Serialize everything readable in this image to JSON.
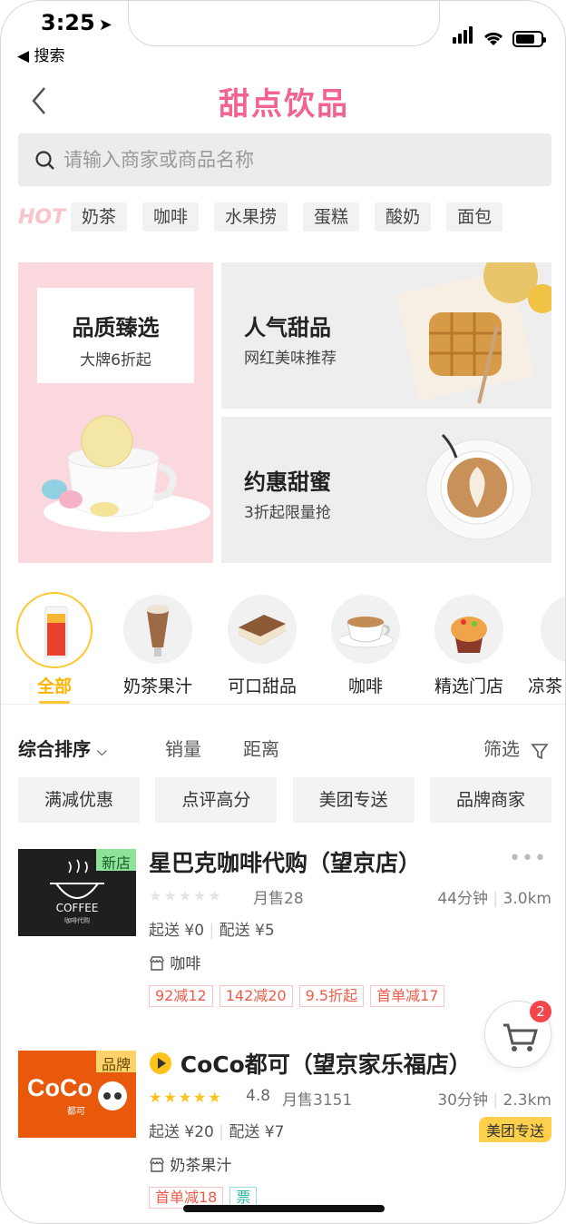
{
  "status_bar": {
    "time": "3:25",
    "back_app": "◀ 搜索"
  },
  "header": {
    "title": "甜点饮品"
  },
  "search": {
    "placeholder": "请输入商家或商品名称"
  },
  "hot": {
    "label": "HOT",
    "tags": [
      "奶茶",
      "咖啡",
      "水果捞",
      "蛋糕",
      "酸奶",
      "面包"
    ]
  },
  "banners": [
    {
      "title": "品质臻选",
      "subtitle": "大牌6折起"
    },
    {
      "title": "人气甜品",
      "subtitle": "网红美味推荐"
    },
    {
      "title": "约惠甜蜜",
      "subtitle": "3折起限量抢"
    }
  ],
  "categories": [
    {
      "label": "全部",
      "active": true
    },
    {
      "label": "奶茶果汁"
    },
    {
      "label": "可口甜品"
    },
    {
      "label": "咖啡"
    },
    {
      "label": "精选门店"
    },
    {
      "label": "凉茶"
    }
  ],
  "sort": {
    "main": "综合排序",
    "sales": "销量",
    "distance": "距离",
    "filter": "筛选"
  },
  "filters": [
    "满减优惠",
    "点评高分",
    "美团专送",
    "品牌商家"
  ],
  "stores": [
    {
      "badge": "新店",
      "thumb_text": "COFFEE",
      "thumb_sub": "咖啡代购",
      "name": "星巴克咖啡代购（望京店）",
      "rating": "",
      "monthly_sales": "月售28",
      "time": "44分钟",
      "distance": "3.0km",
      "min_order": "起送 ¥0",
      "delivery_fee": "配送 ¥5",
      "category": "咖啡",
      "promos": [
        "92减12",
        "142减20",
        "9.5折起",
        "首单减17"
      ]
    },
    {
      "badge": "品牌",
      "thumb_text": "CoCo",
      "thumb_sub": "都可",
      "name": "CoCo都可（望京家乐福店）",
      "rating": "4.8",
      "monthly_sales": "月售3151",
      "time": "30分钟",
      "distance": "2.3km",
      "min_order": "起送 ¥20",
      "delivery_fee": "配送 ¥7",
      "delivery_badge": "美团专送",
      "category": "奶茶果汁",
      "promos": [
        "首单减18"
      ],
      "ticket": "票"
    }
  ],
  "cart": {
    "count": "2"
  },
  "colors": {
    "brand_pink": "#f2638f",
    "accent_yellow": "#ffc832",
    "promo_red": "#f05a4b"
  }
}
